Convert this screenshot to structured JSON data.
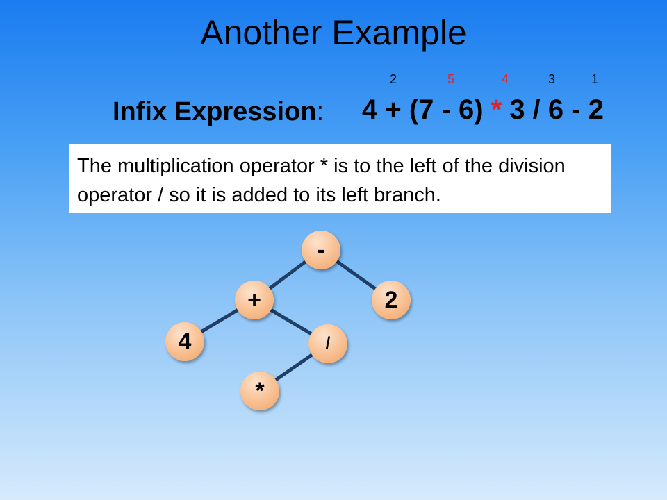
{
  "slide": {
    "title": "Another Example",
    "infix_label": "Infix Expression",
    "infix_colon": ":",
    "expression": {
      "before": "4 + (7 - 6) ",
      "highlight": "*",
      "after": " 3 / 6 - 2"
    },
    "order_numbers": [
      "2",
      "5",
      "4",
      "3",
      "1"
    ],
    "note": "The multiplication operator * is to the left of the division operator / so it is added to its left branch."
  },
  "tree": {
    "nodes": {
      "root": "-",
      "plus": "+",
      "two": "2",
      "four": "4",
      "div": "/",
      "mult": "*"
    },
    "edges": [
      [
        "root",
        "plus"
      ],
      [
        "root",
        "two"
      ],
      [
        "plus",
        "four"
      ],
      [
        "plus",
        "div"
      ],
      [
        "div",
        "mult"
      ]
    ]
  },
  "colors": {
    "highlight": "#e0242a",
    "edge": "#1f3f66",
    "node_fill": "#f9c59a"
  }
}
